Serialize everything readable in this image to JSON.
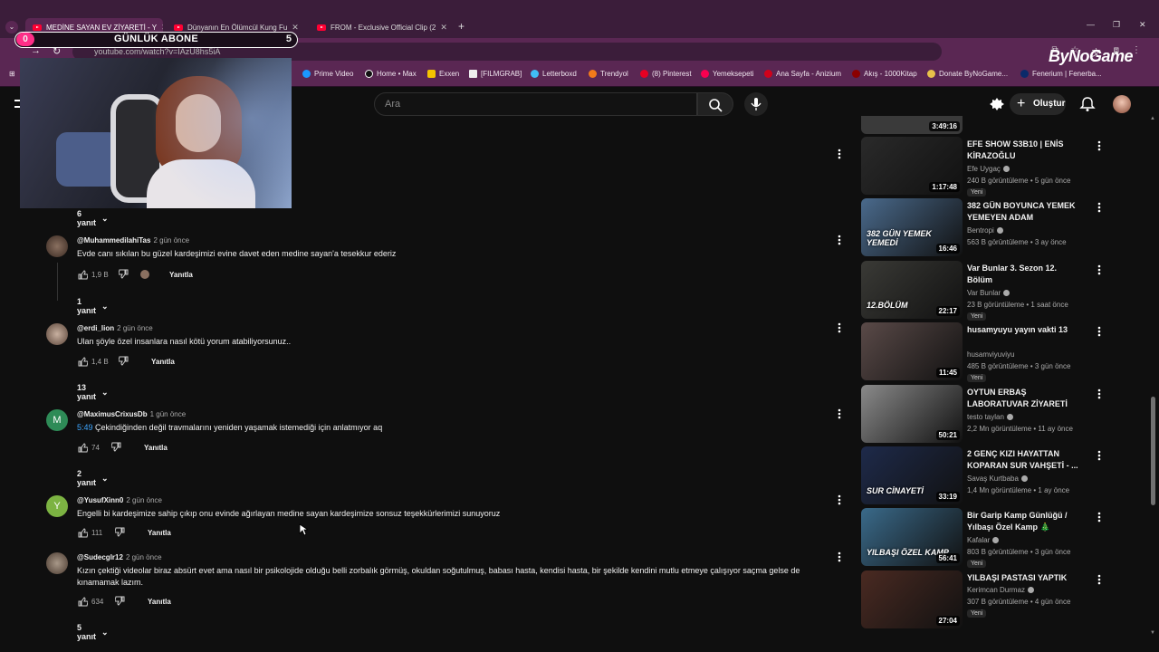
{
  "browser": {
    "tabs": [
      {
        "title": "MEDİNE SAYAN EV ZİYARETİ - Y"
      },
      {
        "title": "Dünyanın En Ölümcül Kung Fu"
      },
      {
        "title": "FROM - Exclusive Official Clip (2"
      }
    ],
    "url": "youtube.com/watch?v=IAzU8hs5iA",
    "bookmarks": [
      "Prime Video",
      "Home • Max",
      "Exxen",
      "[FILMGRAB]",
      "Letterboxd",
      "Trendyol",
      "(8) Pinterest",
      "Yemeksepeti",
      "Ana Sayfa - Anizium",
      "Akış - 1000Kitap",
      "Donate ByNoGame...",
      "Fenerium | Fenerba..."
    ],
    "brand": "ByNoGame"
  },
  "overlay": {
    "current": "0",
    "label": "GÜNLÜK ABONE",
    "goal": "5"
  },
  "header": {
    "search_placeholder": "Ara",
    "create_label": "Oluştur"
  },
  "comments": [
    {
      "replies": "6 yanıt"
    },
    {
      "user": "@MuhammedilahiTas",
      "time": "2 gün önce",
      "text": "Evde canı sıkılan bu güzel kardeşimizi evine davet eden medine sayan'a tesekkur ederiz",
      "likes": "1,9 B",
      "reply": "Yanıtla",
      "replies": "1 yanıt"
    },
    {
      "user": "@erdi_lion",
      "time": "2 gün önce",
      "text": "Ulan şöyle özel insanlara nasıl kötü yorum atabiliyorsunuz..",
      "likes": "1,4 B",
      "reply": "Yanıtla",
      "replies": "13 yanıt"
    },
    {
      "user": "@MaximusCrixusDb",
      "time": "1 gün önce",
      "ts": "5:49",
      "text": " Çekindiğinden değil travmalarını yeniden yaşamak istemediği için anlatmıyor aq",
      "likes": "74",
      "reply": "Yanıtla",
      "replies": "2 yanıt",
      "initial": "M"
    },
    {
      "user": "@YusufXinn0",
      "time": "2 gün önce",
      "text": "Engelli bi kardeşimize sahip çıkıp onu evinde ağırlayan medine sayan kardeşimize sonsuz teşekkürlerimizi sunuyoruz",
      "likes": "111",
      "reply": "Yanıtla",
      "initial": "Y"
    },
    {
      "user": "@Sudecglr12",
      "time": "2 gün önce",
      "text": "Kızın çektiği videolar biraz absürt evet ama nasıl bir psikolojide olduğu belli zorbalık görmüş, okuldan soğutulmuş, babası hasta, kendisi hasta, bir şekilde kendini mutlu etmeye çalışıyor saçma gelse de kınamamak lazım.",
      "likes": "634",
      "reply": "Yanıtla",
      "replies": "5 yanıt"
    }
  ],
  "sidebar": {
    "top_duration": "3:49:16",
    "videos": [
      {
        "title": "EFE SHOW S3B10 | ENİS KİRAZOĞLU",
        "channel": "Efe Uygaç",
        "meta": "240 B görüntüleme • 5 gün önce",
        "badge": "Yeni",
        "duration": "1:17:48",
        "color": "#2a2a2a"
      },
      {
        "title": "382 GÜN BOYUNCA YEMEK YEMEYEN ADAM",
        "channel": "Bentropi",
        "meta": "563 B görüntüleme • 3 ay önce",
        "duration": "16:46",
        "color": "#4a6a8c",
        "overlay": "382 GÜN YEMEK YEMEDİ"
      },
      {
        "title": "Var Bunlar 3. Sezon 12. Bölüm",
        "channel": "Var Bunlar",
        "meta": "23 B görüntüleme • 1 saat önce",
        "badge": "Yeni",
        "duration": "22:17",
        "color": "#3a3a36",
        "overlay": "12.BÖLÜM"
      },
      {
        "title": "husamyuyu yayın vakti 13",
        "channel": "husamviyuviyu",
        "meta": "485 B görüntüleme • 3 gün önce",
        "badge": "Yeni",
        "duration": "11:45",
        "color": "#5a4a48"
      },
      {
        "title": "OYTUN ERBAŞ LABORATUVAR ZİYARETİ",
        "channel": "testo taylan",
        "meta": "2,2 Mn görüntüleme • 11 ay önce",
        "duration": "50:21",
        "color": "#8a8a8a"
      },
      {
        "title": "2 GENÇ KIZI HAYATTAN KOPARAN SUR VAHŞETİ - ...",
        "channel": "Savaş Kurtbaba",
        "meta": "1,4 Mn görüntüleme • 1 ay önce",
        "duration": "33:19",
        "color": "#1e2a4a",
        "overlay": "SUR CİNAYETİ"
      },
      {
        "title": "Bir Garip Kamp Günlüğü / Yılbaşı Özel Kamp 🎄",
        "channel": "Kafalar",
        "meta": "803 B görüntüleme • 3 gün önce",
        "badge": "Yeni",
        "duration": "56:41",
        "color": "#3a6a8a",
        "overlay": "YILBAŞI ÖZEL KAMP"
      },
      {
        "title": "YILBAŞI PASTASI YAPTIK",
        "channel": "Kerimcan Durmaz",
        "meta": "307 B görüntüleme • 4 gün önce",
        "badge": "Yeni",
        "duration": "27:04",
        "color": "#4a2a22"
      }
    ]
  }
}
